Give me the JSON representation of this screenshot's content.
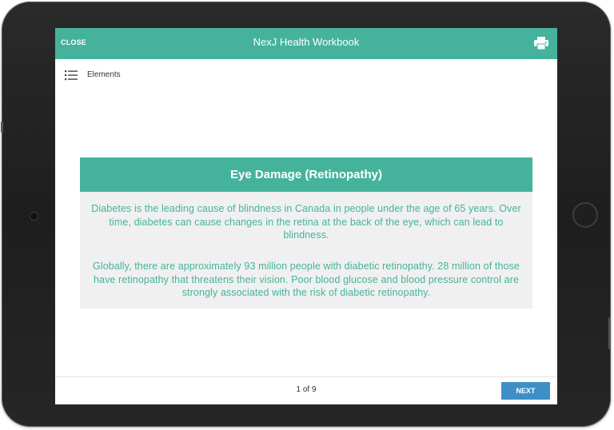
{
  "header": {
    "close_label": "CLOSE",
    "title": "NexJ Health Workbook",
    "print_icon": "printer-icon"
  },
  "toolbar": {
    "elements_icon": "list-icon",
    "elements_label": "Elements"
  },
  "content": {
    "title": "Eye Damage (Retinopathy)",
    "paragraphs": [
      "Diabetes is the leading cause of blindness in Canada in people under the age of 65 years. Over time, diabetes can cause changes in the retina at the back of the eye, which can lead to blindness.",
      "Globally, there are approximately 93 million people with diabetic retinopathy. 28 million of those have retinopathy that threatens their vision.  Poor blood glucose and blood pressure control are strongly associated with the risk of diabetic retinopathy."
    ]
  },
  "footer": {
    "page_indicator": "1 of 9",
    "next_label": "NEXT"
  },
  "colors": {
    "accent": "#45b39c",
    "next_button": "#3f8fc7",
    "card_background": "#f0f0f0",
    "device_frame": "#222222"
  }
}
